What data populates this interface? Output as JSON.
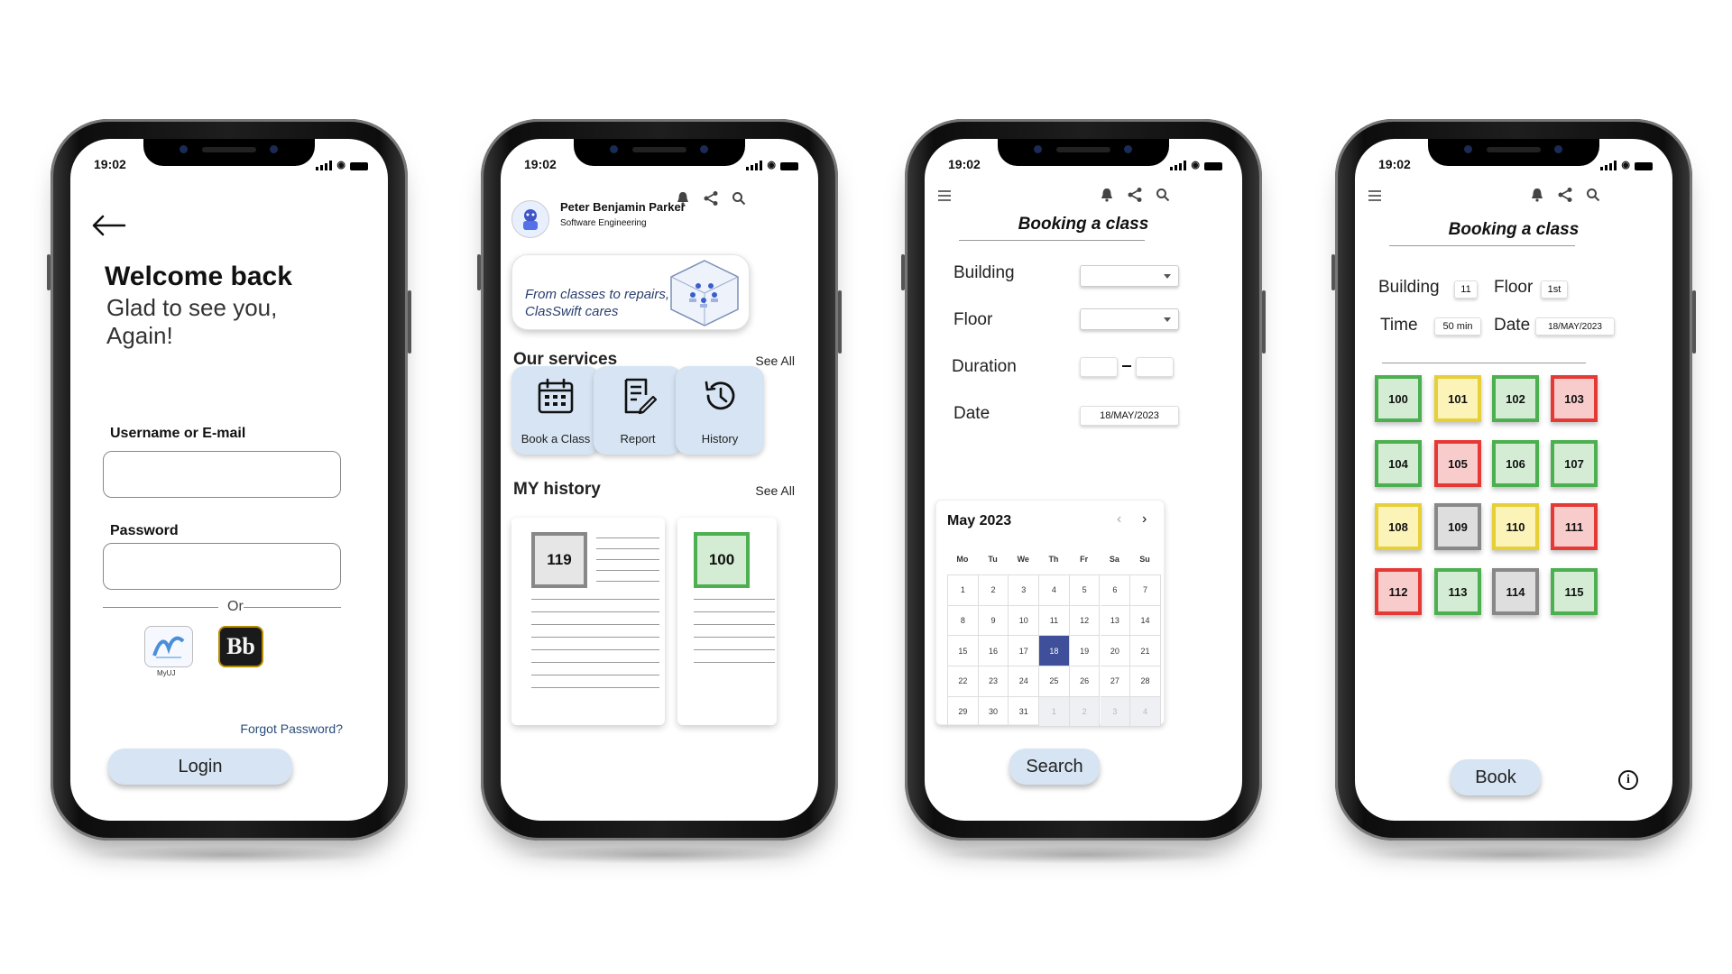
{
  "status": {
    "time": "19:02"
  },
  "colors": {
    "accent": "#d6e4f3",
    "selected_day": "#3f4f9a",
    "free": "#4caf50",
    "partial": "#e6cf37",
    "booked": "#e53935",
    "unavailable": "#888888"
  },
  "login": {
    "title": "Welcome back",
    "subtitle": "Glad to see you, Again!",
    "username_label": "Username or E-mail",
    "username_value": "",
    "password_label": "Password",
    "password_value": "",
    "or_text": "Or",
    "myuj_label": "MyUJ",
    "bb_label": "Bb",
    "forgot_label": "Forgot Password?",
    "login_label": "Login"
  },
  "home": {
    "user_name": "Peter Benjamin Parker",
    "user_dept": "Software Engineering",
    "banner_text": "From classes to repairs, ClasSwift cares",
    "services_title": "Our services",
    "see_all": "See All",
    "services": [
      {
        "label": "Book a Class",
        "icon": "calendar-icon"
      },
      {
        "label": "Report",
        "icon": "report-icon"
      },
      {
        "label": "History",
        "icon": "history-icon"
      }
    ],
    "history_title": "MY history",
    "history_see_all": "See All",
    "history": [
      {
        "room": "119",
        "color": "#888888"
      },
      {
        "room": "100",
        "color": "#4caf50"
      }
    ]
  },
  "booking": {
    "title": "Booking a class",
    "building_label": "Building",
    "floor_label": "Floor",
    "duration_label": "Duration",
    "date_label": "Date",
    "date_value": "18/MAY/2023",
    "month": "May 2023",
    "weekdays": [
      "Mo",
      "Tu",
      "We",
      "Th",
      "Fr",
      "Sa",
      "Su"
    ],
    "days": [
      "1",
      "2",
      "3",
      "4",
      "5",
      "6",
      "7",
      "8",
      "9",
      "10",
      "11",
      "12",
      "13",
      "14",
      "15",
      "16",
      "17",
      "18",
      "19",
      "20",
      "21",
      "22",
      "23",
      "24",
      "25",
      "26",
      "27",
      "28",
      "29",
      "30",
      "31",
      "1",
      "2",
      "3",
      "4"
    ],
    "selected_day": "18",
    "search_label": "Search"
  },
  "rooms": {
    "title": "Booking a class",
    "building_label": "Building",
    "building_value": "11",
    "floor_label": "Floor",
    "floor_value": "1st",
    "time_label": "Time",
    "time_value": "50 min",
    "date_label": "Date",
    "date_value": "18/MAY/2023",
    "book_label": "Book",
    "info_label": "i",
    "list": [
      {
        "id": "100",
        "status": "free"
      },
      {
        "id": "101",
        "status": "partial"
      },
      {
        "id": "102",
        "status": "free"
      },
      {
        "id": "103",
        "status": "booked"
      },
      {
        "id": "104",
        "status": "free"
      },
      {
        "id": "105",
        "status": "booked"
      },
      {
        "id": "106",
        "status": "free"
      },
      {
        "id": "107",
        "status": "free"
      },
      {
        "id": "108",
        "status": "partial"
      },
      {
        "id": "109",
        "status": "unavailable"
      },
      {
        "id": "110",
        "status": "partial"
      },
      {
        "id": "111",
        "status": "booked"
      },
      {
        "id": "112",
        "status": "booked"
      },
      {
        "id": "113",
        "status": "free"
      },
      {
        "id": "114",
        "status": "unavailable"
      },
      {
        "id": "115",
        "status": "free"
      }
    ]
  }
}
